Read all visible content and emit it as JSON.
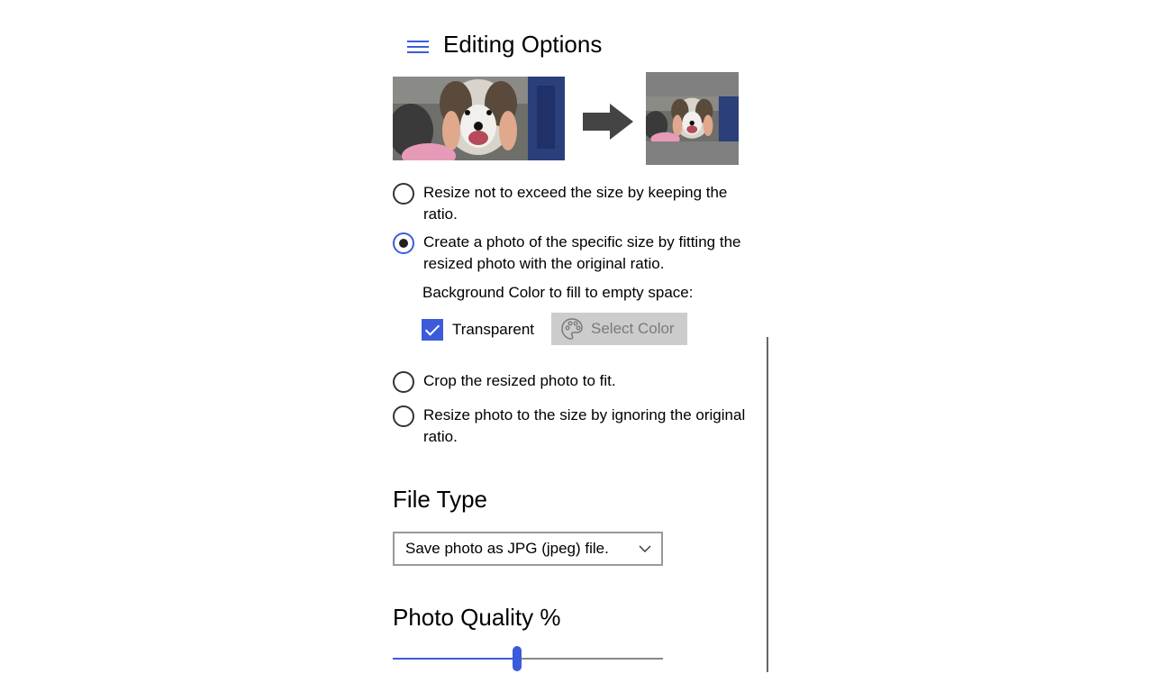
{
  "header": {
    "title": "Editing Options",
    "menu_icon": "hamburger-menu-icon"
  },
  "preview": {
    "arrow_icon": "right-arrow-icon",
    "frame_color": "#808080"
  },
  "resize_options": [
    {
      "label": "Resize not to exceed the size by keeping the ratio.",
      "selected": false
    },
    {
      "label": "Create a photo of the specific size by fitting the resized photo with the original ratio.",
      "selected": true
    },
    {
      "label": "Crop the resized photo to fit.",
      "selected": false
    },
    {
      "label": "Resize photo to the size by ignoring the original ratio.",
      "selected": false
    }
  ],
  "background": {
    "label": "Background Color to fill to empty space:",
    "transparent_label": "Transparent",
    "transparent_checked": true,
    "select_color_label": "Select Color",
    "select_color_icon": "palette-icon"
  },
  "file_type": {
    "title": "File Type",
    "selected": "Save photo as JPG (jpeg) file."
  },
  "quality": {
    "title": "Photo Quality %",
    "value_fraction": 0.46
  },
  "colors": {
    "accent": "#3b5bdb",
    "button_disabled_bg": "#cccccc",
    "button_disabled_text": "#7a7a7a"
  }
}
